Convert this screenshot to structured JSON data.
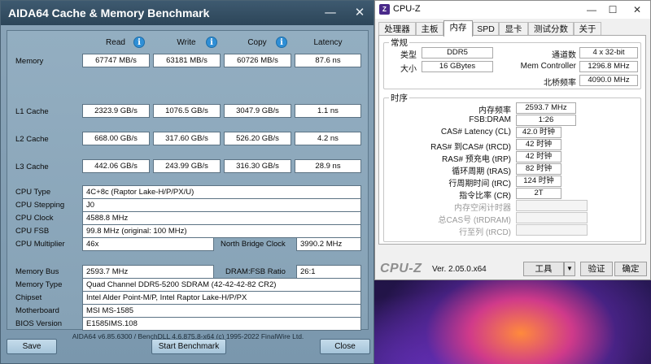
{
  "aida": {
    "title": "AIDA64 Cache & Memory Benchmark",
    "minimize_glyph": "—",
    "close_glyph": "✕",
    "columns": {
      "read": "Read",
      "write": "Write",
      "copy": "Copy",
      "latency": "Latency"
    },
    "info_glyph": "i",
    "rows": {
      "memory": {
        "label": "Memory",
        "read": "67747 MB/s",
        "write": "63181 MB/s",
        "copy": "60726 MB/s",
        "latency": "87.6 ns"
      },
      "l1": {
        "label": "L1 Cache",
        "read": "2323.9 GB/s",
        "write": "1076.5 GB/s",
        "copy": "3047.9 GB/s",
        "latency": "1.1 ns"
      },
      "l2": {
        "label": "L2 Cache",
        "read": "668.00 GB/s",
        "write": "317.60 GB/s",
        "copy": "526.20 GB/s",
        "latency": "4.2 ns"
      },
      "l3": {
        "label": "L3 Cache",
        "read": "442.06 GB/s",
        "write": "243.99 GB/s",
        "copy": "316.30 GB/s",
        "latency": "28.9 ns"
      }
    },
    "cpu": {
      "type_label": "CPU Type",
      "type": "4C+8c  (Raptor Lake-H/P/PX/U)",
      "stepping_label": "CPU Stepping",
      "stepping": "J0",
      "clock_label": "CPU Clock",
      "clock": "4588.8 MHz",
      "fsb_label": "CPU FSB",
      "fsb": "99.8 MHz  (original: 100 MHz)",
      "multiplier_label": "CPU Multiplier",
      "multiplier": "46x",
      "nb_clock_label": "North Bridge Clock",
      "nb_clock": "3990.2 MHz"
    },
    "memory_info": {
      "bus_label": "Memory Bus",
      "bus": "2593.7 MHz",
      "ratio_label": "DRAM:FSB Ratio",
      "ratio": "26:1",
      "type_label": "Memory Type",
      "type": "Quad Channel DDR5-5200 SDRAM  (42-42-42-82 CR2)",
      "chipset_label": "Chipset",
      "chipset": "Intel Alder Point-M/P, Intel Raptor Lake-H/P/PX",
      "motherboard_label": "Motherboard",
      "motherboard": "MSI MS-1585",
      "bios_label": "BIOS Version",
      "bios": "E1585IMS.108"
    },
    "footer": "AIDA64 v6.85.6300 / BenchDLL 4.6.875.8-x64  (c) 1995-2022 FinalWire Ltd.",
    "buttons": {
      "save": "Save",
      "start": "Start Benchmark",
      "close": "Close"
    }
  },
  "cpuz": {
    "title": "CPU-Z",
    "logo_text": "Z",
    "minimize_glyph": "—",
    "maximize_glyph": "☐",
    "close_glyph": "✕",
    "tabs": [
      "处理器",
      "主板",
      "内存",
      "SPD",
      "显卡",
      "测试分数",
      "关于"
    ],
    "active_tab": "内存",
    "general": {
      "group_title": "常规",
      "type_label": "类型",
      "type": "DDR5",
      "channels_label": "通道数",
      "channels": "4 x 32-bit",
      "size_label": "大小",
      "size": "16 GBytes",
      "mem_ctrl_label": "Mem Controller",
      "mem_ctrl": "1296.8 MHz",
      "nb_freq_label": "北桥频率",
      "nb_freq": "4090.0 MHz"
    },
    "timings": {
      "group_title": "时序",
      "dram_freq_label": "内存频率",
      "dram_freq": "2593.7 MHz",
      "fsb_dram_label": "FSB:DRAM",
      "fsb_dram": "1:26",
      "cl_label": "CAS# Latency (CL)",
      "cl": "42.0 时钟",
      "trcd_label": "RAS# 到CAS# (tRCD)",
      "trcd": "42 时钟",
      "trp_label": "RAS# 预充电 (tRP)",
      "trp": "42 时钟",
      "tras_label": "循环周期 (tRAS)",
      "tras": "82 时钟",
      "trc_label": "行周期时间 (tRC)",
      "trc": "124 时钟",
      "cr_label": "指令比率 (CR)",
      "cr": "2T",
      "idle_label": "内存空闲计时器",
      "idle": "",
      "trdram_label": "总CAS号 (tRDRAM)",
      "trdram": "",
      "trcd2_label": "行至列 (tRCD)",
      "trcd2": ""
    },
    "footer": {
      "brand": "CPU-Z",
      "version": "Ver. 2.05.0.x64",
      "tools": "工具",
      "dropdown_glyph": "▼",
      "validate": "验证",
      "ok": "确定"
    }
  }
}
